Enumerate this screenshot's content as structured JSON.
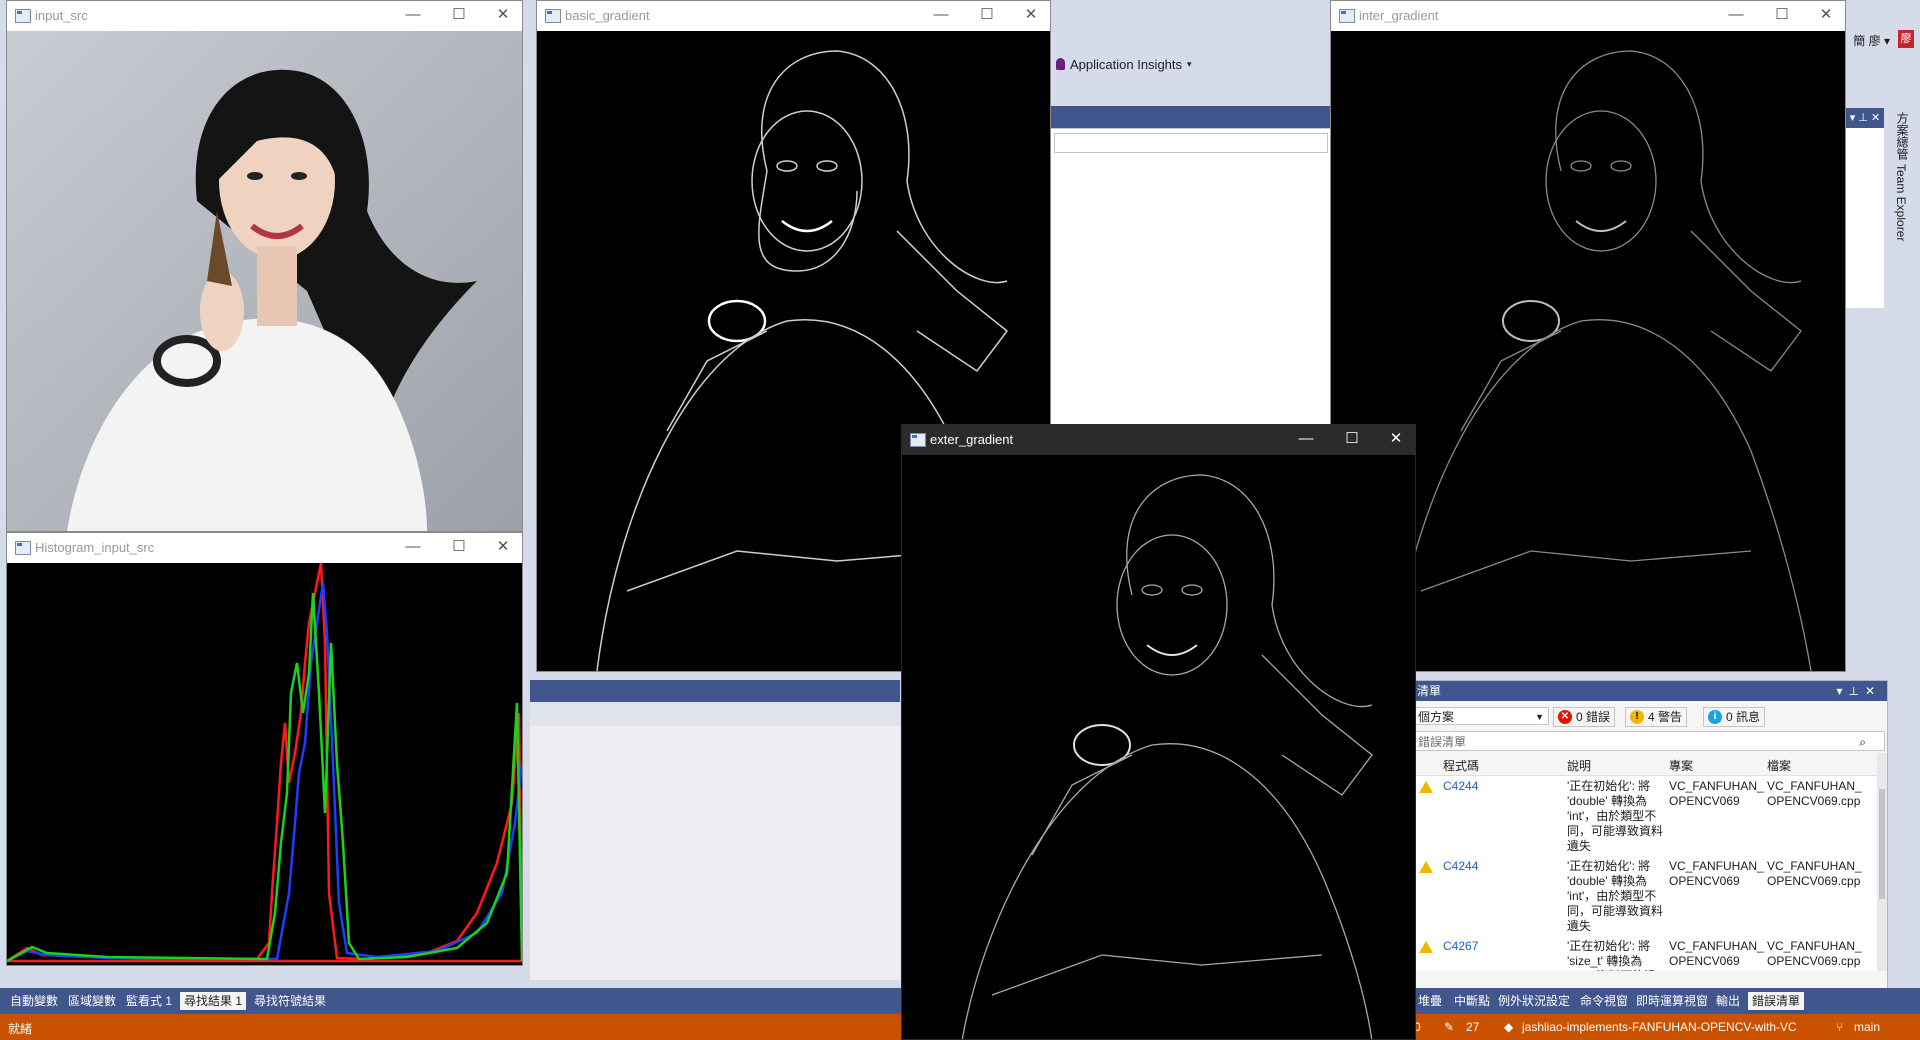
{
  "ide": {
    "application_insights": "Application Insights",
    "right_top": "簡 廖 ▾",
    "right_top_badge": "廖",
    "solution_explorer_tab": "方案總管",
    "team_explorer_tab": "Team Explorer",
    "bottom_tabs": [
      "自動變數",
      "區域變數",
      "監看式 1",
      "尋找結果 1",
      "尋找符號結果"
    ],
    "bottom_tabs_right": [
      "堆疊",
      "中斷點",
      "例外狀況設定",
      "命令視窗",
      "即時運算視窗",
      "輸出",
      "錯誤清單"
    ],
    "active_bottom_tab": "尋找結果 1",
    "status_left": "就緒",
    "status_num_left": "0",
    "status_edits": "27",
    "status_repo": "jashliao-implements-FANFUHAN-OPENCV-with-VC",
    "status_branch": "main"
  },
  "error_list": {
    "title": "清單",
    "scope": "個方案",
    "errors_label": "0 錯誤",
    "warnings_label": "4 警告",
    "messages_label": "0 訊息",
    "search_placeholder": "錯誤清單",
    "columns": [
      "程式碼",
      "說明",
      "專案",
      "檔案"
    ],
    "rows": [
      {
        "code": "C4244",
        "desc": "'正在初始化': 將 'double' 轉換為 'int'，由於類型不同，可能導致資料遺失",
        "project": "VC_FANFUHAN_ OPENCV069",
        "file": "VC_FANFUHAN_ OPENCV069.cpp"
      },
      {
        "code": "C4244",
        "desc": "'正在初始化': 將 'double' 轉換為 'int'，由於類型不同，可能導致資料遺失",
        "project": "VC_FANFUHAN_ OPENCV069",
        "file": "VC_FANFUHAN_ OPENCV069.cpp"
      },
      {
        "code": "C4267",
        "desc": "'正在初始化': 將 'size_t' 轉換為 'int'，資料可能遺失",
        "project": "VC_FANFUHAN_ OPENCV069",
        "file": "VC_FANFUHAN_ OPENCV069.cpp"
      }
    ]
  },
  "windows": {
    "input_src": "input_src",
    "histogram": "Histogram_input_src",
    "basic": "basic_gradient",
    "inter": "inter_gradient",
    "exter": "exter_gradient"
  },
  "window_controls": {
    "minimize": "—",
    "maximize": "☐",
    "close": "✕"
  },
  "colors": {
    "vs_blue": "#40568d",
    "status_orange": "#ca5100",
    "warning": "#f2b600",
    "link": "#1a62c7"
  }
}
